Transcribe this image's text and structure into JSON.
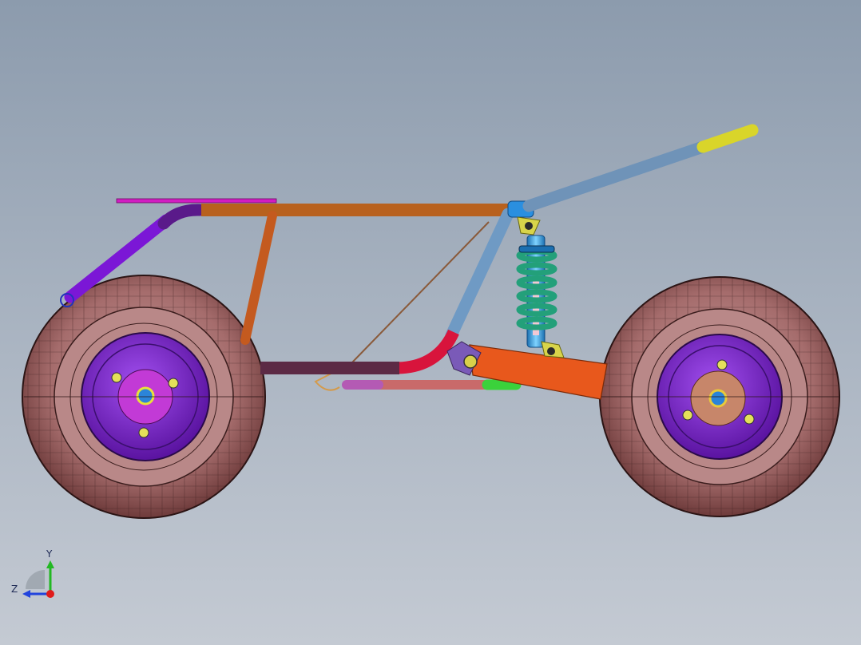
{
  "viewport": {
    "background_top": "#8c9bad",
    "background_bottom": "#c4cad3"
  },
  "model": {
    "components": [
      "frame-top-rail",
      "frame-seat-bar",
      "frame-rear-upright",
      "frame-rear-diagonal-tube",
      "frame-lower-rail",
      "frame-front-downtube",
      "steering-handlebar",
      "handlebar-grip",
      "shock-absorber",
      "swing-arm",
      "brace-rod",
      "rear-wheel",
      "front-wheel"
    ],
    "colors": {
      "top_rail": "#b8611e",
      "seat_bar": "#d21cc2",
      "rear_diagonal": "#7b17d6",
      "rear_upright": "#c45a1f",
      "lower_rail_dark": "#5c2a45",
      "lower_rail_red": "#d8143c",
      "downtube": "#6f9ac4",
      "handlebar": "#6f93b8",
      "grip": "#d9d52a",
      "neck_joint": "#2a8fe0",
      "swing_arm": "#e8581c",
      "lower_bar": "#c96a6a",
      "lower_bar_end": "#3bd23b",
      "shock_spring": "#23a07a",
      "shock_body": "#3aa8e6",
      "tire": "#b07a7a",
      "rim": "#8f2fdc",
      "hub_rear": "#c23ad6",
      "hub_front": "#c7866a"
    }
  },
  "triad": {
    "y_label": "Y",
    "z_label": "Z",
    "y_color": "#22b822",
    "z_color": "#2244dd",
    "x_color": "#e01b1b"
  }
}
